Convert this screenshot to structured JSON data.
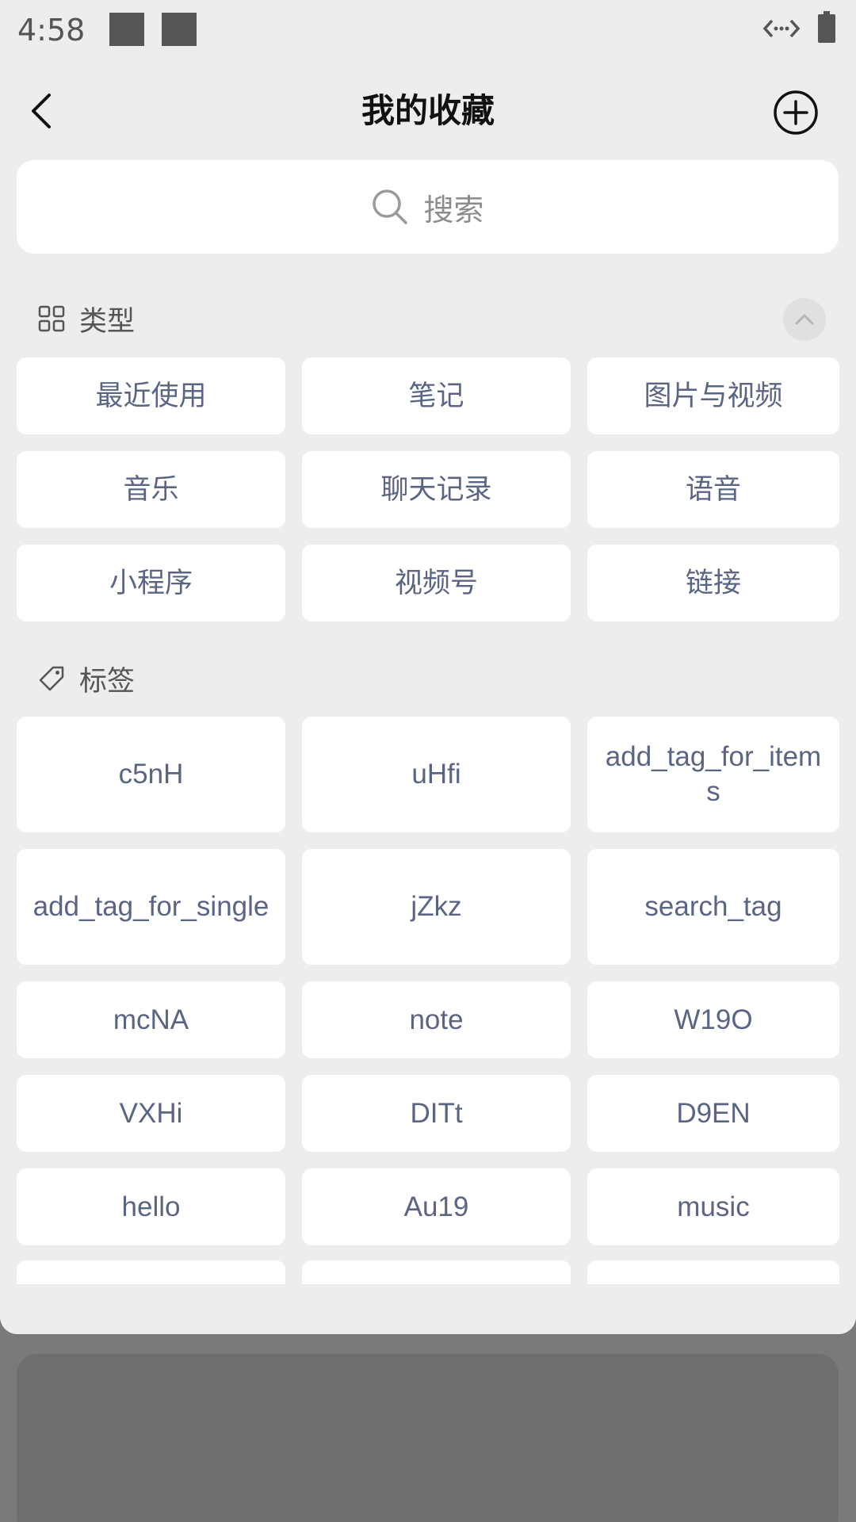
{
  "status_bar": {
    "time": "4:58"
  },
  "header": {
    "title": "我的收藏",
    "back_icon": "chevron-left-icon",
    "add_icon": "plus-circle-icon"
  },
  "search": {
    "placeholder": "搜索",
    "icon": "search-icon"
  },
  "types_section": {
    "label": "类型",
    "icon": "grid-icon",
    "collapse_icon": "chevron-up-icon",
    "items": [
      "最近使用",
      "笔记",
      "图片与视频",
      "音乐",
      "聊天记录",
      "语音",
      "小程序",
      "视频号",
      "链接"
    ]
  },
  "tags_section": {
    "label": "标签",
    "icon": "tag-icon",
    "items": [
      "c5nH",
      "uHfi",
      "add_tag_for_items",
      "add_tag_for_single",
      "jZkz",
      "search_tag",
      "mcNA",
      "note",
      "W19O",
      "VXHi",
      "DITt",
      "D9EN",
      "hello",
      "Au19",
      "music"
    ]
  },
  "colors": {
    "sheet_bg": "#ededed",
    "card_bg": "#ffffff",
    "item_text": "#5a6584",
    "overlay": "#7a7a7a"
  }
}
